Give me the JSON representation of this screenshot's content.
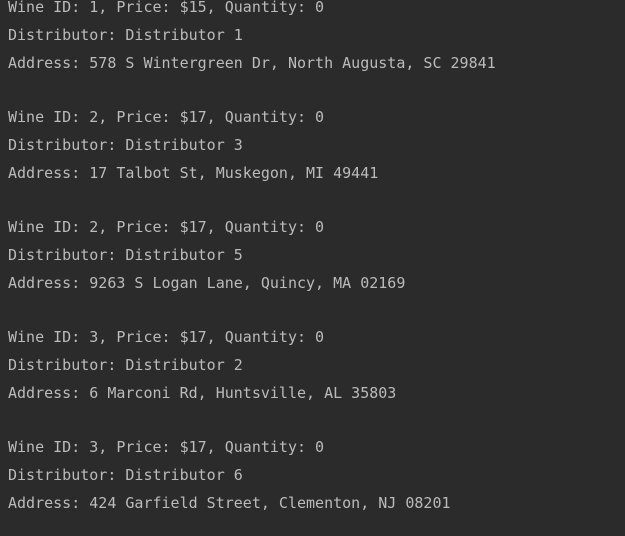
{
  "console": {
    "entries": [
      {
        "wine_line": "Wine ID: 1, Price: $15, Quantity: 0",
        "distributor_line": "Distributor: Distributor 1",
        "address_line": "Address: 578 S Wintergreen Dr, North Augusta, SC 29841"
      },
      {
        "wine_line": "Wine ID: 2, Price: $17, Quantity: 0",
        "distributor_line": "Distributor: Distributor 3",
        "address_line": "Address: 17 Talbot St, Muskegon, MI 49441"
      },
      {
        "wine_line": "Wine ID: 2, Price: $17, Quantity: 0",
        "distributor_line": "Distributor: Distributor 5",
        "address_line": "Address: 9263 S Logan Lane, Quincy, MA 02169"
      },
      {
        "wine_line": "Wine ID: 3, Price: $17, Quantity: 0",
        "distributor_line": "Distributor: Distributor 2",
        "address_line": "Address: 6 Marconi Rd, Huntsville, AL 35803"
      },
      {
        "wine_line": "Wine ID: 3, Price: $17, Quantity: 0",
        "distributor_line": "Distributor: Distributor 6",
        "address_line": "Address: 424 Garfield Street, Clementon, NJ 08201"
      }
    ]
  },
  "colors": {
    "background": "#2b2b2b",
    "text": "#bbbbbb"
  }
}
